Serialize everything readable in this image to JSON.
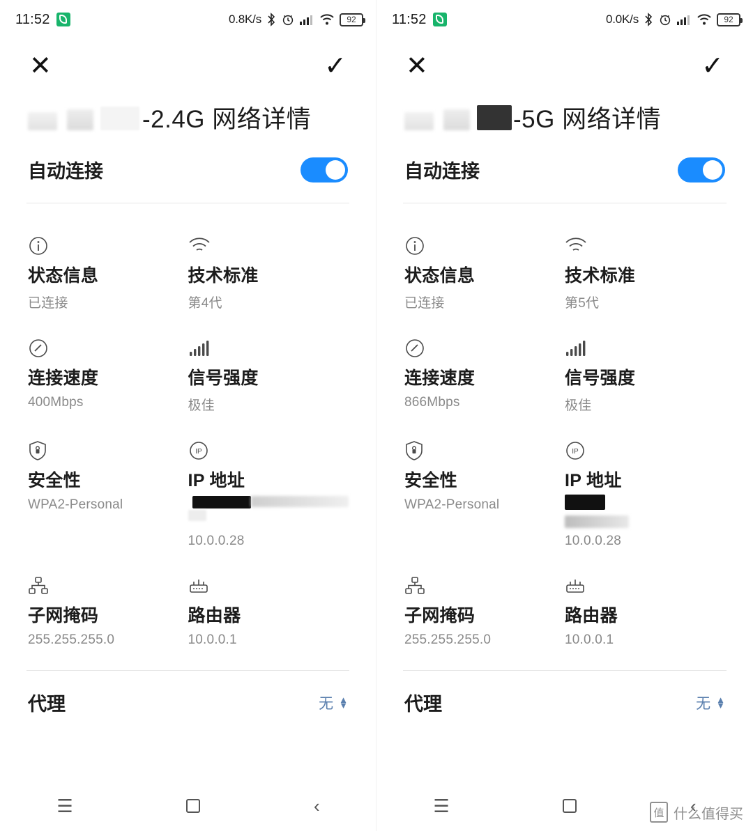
{
  "screens": [
    {
      "id": "left",
      "status": {
        "clock": "11:52",
        "nfc_icon": "nfc-icon",
        "net_speed": "0.8K/s",
        "bluetooth_icon": "bluetooth-icon",
        "alarm_icon": "alarm-icon",
        "signal_icon": "cellular-signal-icon",
        "wifi_icon": "wifi-icon",
        "battery_level": "92"
      },
      "topbar": {
        "close_label": "✕",
        "confirm_label": "✓"
      },
      "title": "-2.4G 网络详情",
      "title_prefix_redacted": true,
      "auto_connect": {
        "label": "自动连接",
        "state": "on"
      },
      "info": [
        {
          "icon": "info-circle-icon",
          "title": "状态信息",
          "value": "已连接"
        },
        {
          "icon": "wifi-icon",
          "title": "技术标准",
          "value": "第4代"
        },
        {
          "icon": "speedometer-icon",
          "title": "连接速度",
          "value": "400Mbps"
        },
        {
          "icon": "signal-bars-icon",
          "title": "信号强度",
          "value": "极佳"
        },
        {
          "icon": "shield-lock-icon",
          "title": "安全性",
          "value": "WPA2-Personal"
        },
        {
          "icon": "ip-circle-icon",
          "title": "IP 地址",
          "value": "10.0.0.28",
          "redacted_lines": true
        },
        {
          "icon": "subnet-icon",
          "title": "子网掩码",
          "value": "255.255.255.0"
        },
        {
          "icon": "router-icon",
          "title": "路由器",
          "value": "10.0.0.1"
        }
      ],
      "proxy": {
        "label": "代理",
        "value": "无"
      },
      "navbar": {
        "menu_icon": "menu-icon",
        "home_icon": "home-square-icon",
        "back_icon": "back-chevron-icon"
      }
    },
    {
      "id": "right",
      "status": {
        "clock": "11:52",
        "nfc_icon": "nfc-icon",
        "net_speed": "0.0K/s",
        "bluetooth_icon": "bluetooth-icon",
        "alarm_icon": "alarm-icon",
        "signal_icon": "cellular-signal-icon",
        "wifi_icon": "wifi-icon",
        "battery_level": "92"
      },
      "topbar": {
        "close_label": "✕",
        "confirm_label": "✓"
      },
      "title": "-5G 网络详情",
      "title_prefix_redacted": true,
      "auto_connect": {
        "label": "自动连接",
        "state": "on"
      },
      "info": [
        {
          "icon": "info-circle-icon",
          "title": "状态信息",
          "value": "已连接"
        },
        {
          "icon": "wifi-icon",
          "title": "技术标准",
          "value": "第5代"
        },
        {
          "icon": "speedometer-icon",
          "title": "连接速度",
          "value": "866Mbps"
        },
        {
          "icon": "signal-bars-icon",
          "title": "信号强度",
          "value": "极佳"
        },
        {
          "icon": "shield-lock-icon",
          "title": "安全性",
          "value": "WPA2-Personal"
        },
        {
          "icon": "ip-circle-icon",
          "title": "IP 地址",
          "value": "10.0.0.28",
          "redacted_lines": true
        },
        {
          "icon": "subnet-icon",
          "title": "子网掩码",
          "value": "255.255.255.0"
        },
        {
          "icon": "router-icon",
          "title": "路由器",
          "value": "10.0.0.1"
        }
      ],
      "proxy": {
        "label": "代理",
        "value": "无"
      },
      "navbar": {
        "menu_icon": "menu-icon",
        "home_icon": "home-square-icon",
        "back_icon": "back-chevron-icon"
      }
    }
  ],
  "watermark": {
    "logo_text": "值",
    "text": "什么值得买"
  },
  "colors": {
    "accent_toggle": "#1a8cff",
    "nfc_green": "#18b46b",
    "proxy_link": "#5a7fae",
    "value_gray": "#8a8a8a"
  }
}
